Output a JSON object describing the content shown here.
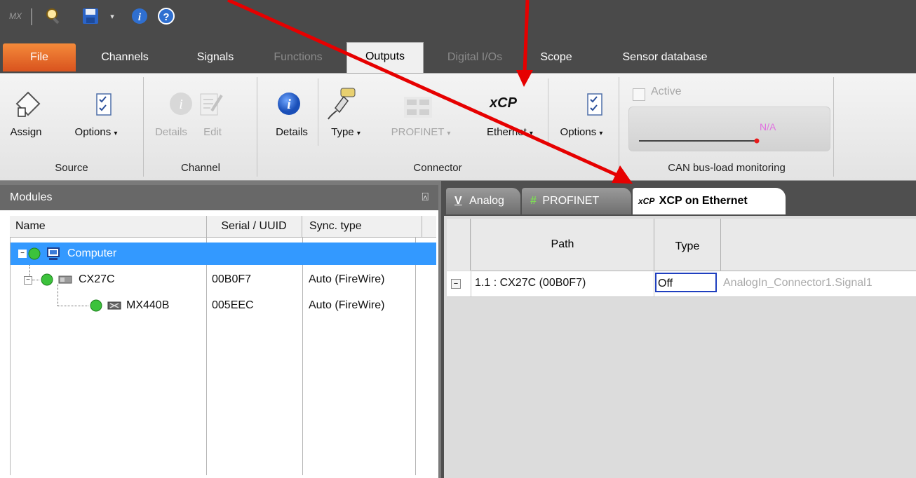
{
  "quick_access": {
    "logo": "MX",
    "icons": [
      "find-icon",
      "save-icon",
      "dropdown-icon",
      "info-icon",
      "help-icon"
    ]
  },
  "ribbon_tabs": [
    {
      "label": "File",
      "state": "file"
    },
    {
      "label": "Channels",
      "state": "enabled"
    },
    {
      "label": "Signals",
      "state": "enabled"
    },
    {
      "label": "Functions",
      "state": "disabled"
    },
    {
      "label": "Outputs",
      "state": "selected"
    },
    {
      "label": "Digital I/Os",
      "state": "disabled"
    },
    {
      "label": "Scope",
      "state": "enabled"
    },
    {
      "label": "Sensor database",
      "state": "enabled"
    }
  ],
  "ribbon": {
    "source": {
      "group_label": "Source",
      "assign": "Assign",
      "options": "Options"
    },
    "channel": {
      "group_label": "Channel",
      "details": "Details",
      "edit": "Edit"
    },
    "connector": {
      "group_label": "Connector",
      "details": "Details",
      "type": "Type",
      "profinet": "PROFINET",
      "profinet_icon_text": "P   N",
      "xcp_icon_text": "xCP",
      "ethernet": "Ethernet",
      "options": "Options"
    },
    "can": {
      "group_label": "CAN bus-load monitoring",
      "active": "Active",
      "value": "N/A"
    }
  },
  "modules": {
    "title": "Modules",
    "pin": "⍓",
    "columns": [
      "Name",
      "Serial / UUID",
      "Sync. type"
    ],
    "rows": [
      {
        "name": "Computer",
        "serial": "",
        "sync": "",
        "selected": true
      },
      {
        "name": "CX27C",
        "serial": "00B0F7",
        "sync": "Auto (FireWire)"
      },
      {
        "name": "MX440B",
        "serial": "005EEC",
        "sync": "Auto (FireWire)"
      }
    ]
  },
  "output_tabs": [
    {
      "icon": "V",
      "label": "Analog"
    },
    {
      "icon": "#",
      "label": "PROFINET"
    },
    {
      "icon": "xCP",
      "label": "XCP on Ethernet",
      "active": true
    }
  ],
  "output_grid": {
    "columns": [
      "Path",
      "Type"
    ],
    "rows": [
      {
        "expander": "−",
        "path": "1.1 : CX27C (00B0F7)",
        "type": "Off",
        "signal": "AnalogIn_Connector1.Signal1"
      }
    ]
  },
  "colors": {
    "accent_selection": "#3399ff",
    "file_tab": "#e2632a",
    "arrow": "#e60000"
  }
}
